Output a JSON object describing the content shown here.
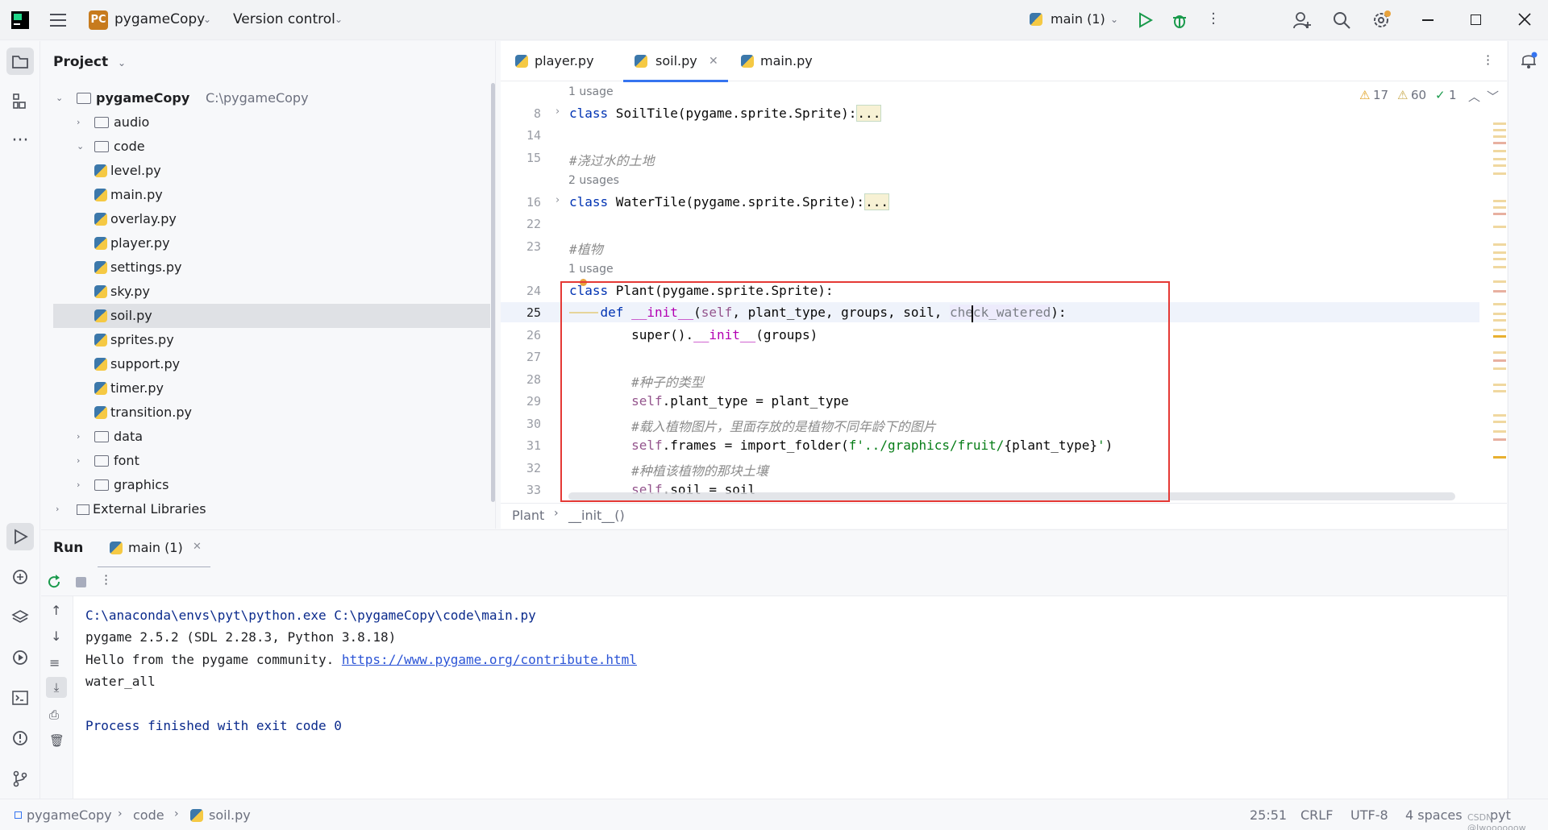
{
  "titlebar": {
    "project_badge": "PC",
    "project_name": "pygameCopy",
    "vcs": "Version control",
    "run_config": "main (1)"
  },
  "project_panel": {
    "title": "Project",
    "root_name": "pygameCopy",
    "root_path": "C:\\pygameCopy",
    "folders": {
      "audio": "audio",
      "code": "code",
      "data": "data",
      "font": "font",
      "graphics": "graphics"
    },
    "files": [
      "level.py",
      "main.py",
      "overlay.py",
      "player.py",
      "settings.py",
      "sky.py",
      "soil.py",
      "sprites.py",
      "support.py",
      "timer.py",
      "transition.py"
    ],
    "external": "External Libraries"
  },
  "editor": {
    "tabs": [
      "player.py",
      "soil.py",
      "main.py"
    ],
    "active_tab": "soil.py",
    "inspections": {
      "warnings": "17",
      "weak_warnings": "60",
      "typos": "1"
    },
    "usage_hints": [
      "1 usage",
      "2 usages",
      "1 usage"
    ],
    "line_numbers": [
      "8",
      "14",
      "15",
      "16",
      "22",
      "23",
      "24",
      "25",
      "26",
      "27",
      "28",
      "29",
      "30",
      "31",
      "32",
      "33"
    ],
    "code": {
      "l8_class": "class",
      "l8_rest": " SoilTile(pygame.sprite.Sprite):",
      "fold": "...",
      "l15": "#浇过水的土地",
      "l16_class": "class",
      "l16_rest": " WaterTile(pygame.sprite.Sprite):",
      "l23": "#植物",
      "l24_class": "class",
      "l24_rest": " Plant(pygame.sprite.Sprite):",
      "l25_def": "def",
      "l25_init": "__init__",
      "l25_p1": "(",
      "l25_self": "self",
      "l25_args": ", plant_type, groups, soil, ",
      "l25_check": "check_watered",
      "l25_end": "):",
      "l26_super": "super().",
      "l26_init": "__init__",
      "l26_rest": "(groups)",
      "l28": "#种子的类型",
      "l29_self": "self",
      "l29_rest": ".plant_type = plant_type",
      "l30": "#载入植物图片，里面存放的是植物不同年龄下的图片",
      "l31_self": "self",
      "l31_mid": ".frames = import_folder(",
      "l31_str1": "f'../graphics/fruit/",
      "l31_interp": "{plant_type}",
      "l31_str2": "'",
      "l31_end": ")",
      "l32": "#种植该植物的那块土壤",
      "l33_self": "self",
      "l33_rest": ".soil = soil"
    },
    "breadcrumb": [
      "Plant",
      "__init__()"
    ]
  },
  "run_panel": {
    "title": "Run",
    "tab": "main (1)",
    "output": {
      "cmd": "C:\\anaconda\\envs\\pyt\\python.exe C:\\pygameCopy\\code\\main.py",
      "line2": "pygame 2.5.2 (SDL 2.28.3, Python 3.8.18)",
      "line3_text": "Hello from the pygame community. ",
      "line3_link": "https://www.pygame.org/contribute.html",
      "line4": "water_all",
      "line5": "Process finished with exit code 0"
    }
  },
  "statusbar": {
    "path": [
      "pygameCopy",
      "code",
      "soil.py"
    ],
    "position": "25:51",
    "line_sep": "CRLF",
    "encoding": "UTF-8",
    "indent": "4 spaces",
    "interpreter": "pyt",
    "watermark": "CSDN @Jwoooooow"
  },
  "icons": {
    "app": "pycharm-logo-icon",
    "menu": "hamburger-menu-icon",
    "python_file": "python-file-icon",
    "folder": "folder-icon"
  }
}
